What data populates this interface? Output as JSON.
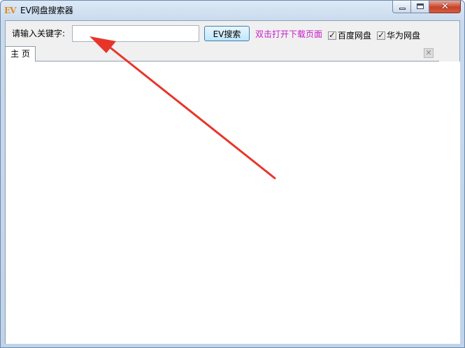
{
  "window": {
    "logo_text": "EV",
    "title": "EV网盘搜索器",
    "controls": {
      "minimize": "minimize",
      "maximize": "maximize",
      "close": "✕"
    }
  },
  "toolbar": {
    "keyword_label": "请输入关键字:",
    "keyword_value": "",
    "keyword_placeholder": "",
    "search_button": "EV搜索",
    "hint": "双击打开下载页面",
    "checkboxes": [
      {
        "label": "百度网盘",
        "checked": true
      },
      {
        "label": "华为网盘",
        "checked": true
      }
    ]
  },
  "tabs": [
    {
      "label": "主 页",
      "active": true
    }
  ],
  "tab_close_glyph": "✕",
  "colors": {
    "hint_text": "#c41dc6",
    "annotation_arrow": "#e8352a"
  },
  "icons": {
    "app": "ev-logo-icon",
    "check": "checkmark-icon",
    "tab_close": "close-icon"
  }
}
